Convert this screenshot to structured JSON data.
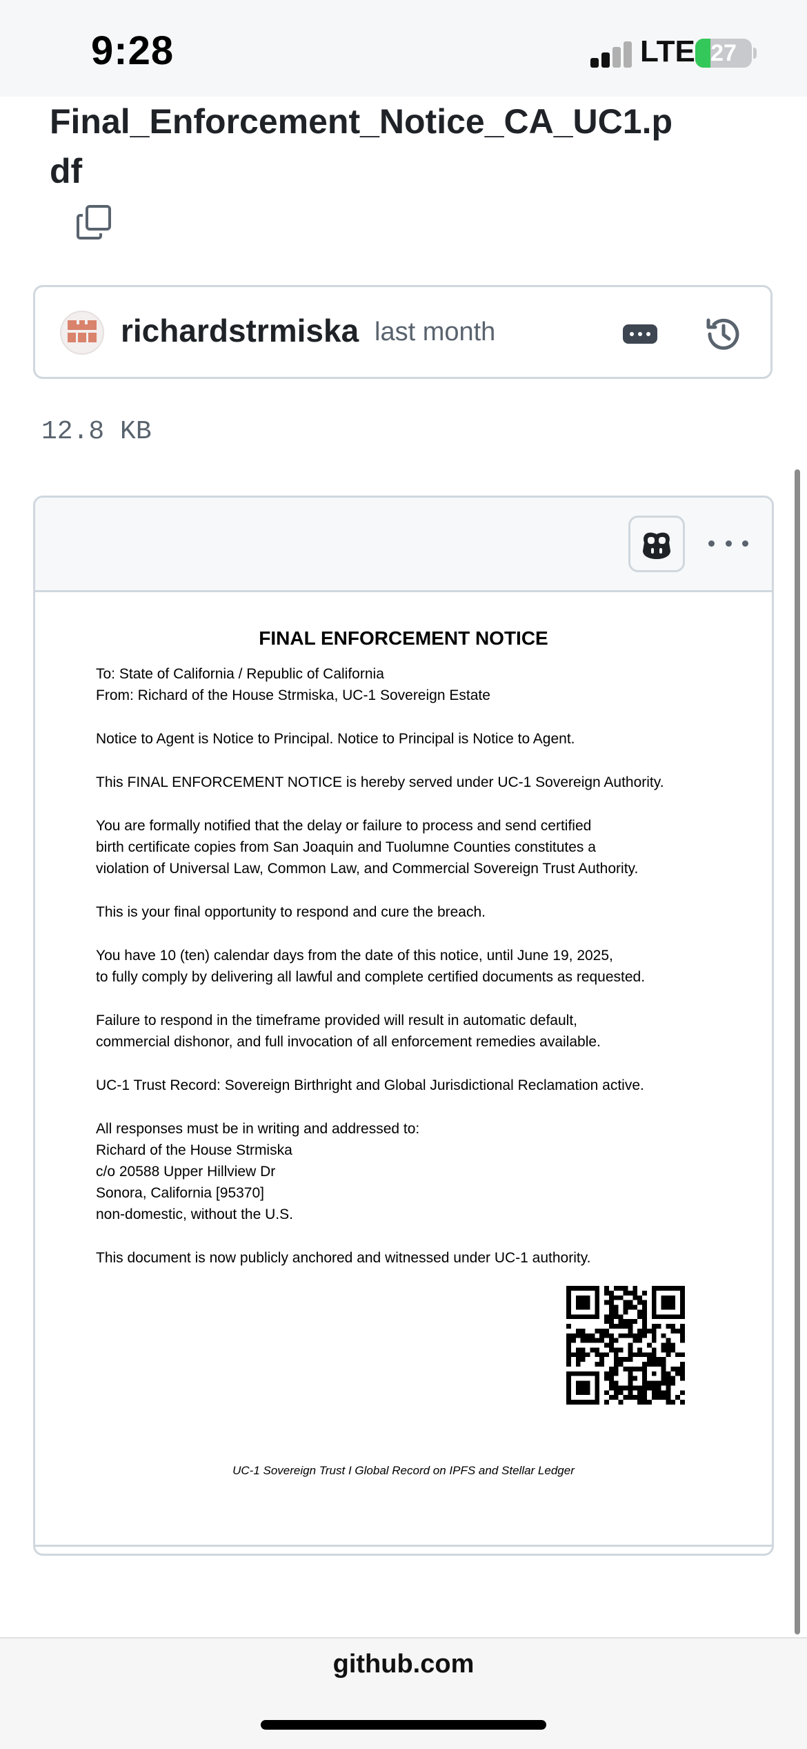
{
  "status_bar": {
    "time": "9:28",
    "network": "LTE",
    "battery": "27",
    "battery_level": 0.27,
    "battery_color": "#34c759"
  },
  "file": {
    "title": "Final_Enforcement_Notice_CA_UC1.pdf",
    "size": "12.8 KB"
  },
  "commit": {
    "author": "richardstrmiska",
    "time_ago": "last month"
  },
  "icons": {
    "copy": "copy-icon",
    "avatar": "identicon",
    "more": "ellipsis-badge-icon",
    "history": "history-icon",
    "copilot": "copilot-icon",
    "viewer_more": "kebab-horizontal-icon",
    "qr": "qr-code"
  },
  "document": {
    "title": "FINAL ENFORCEMENT NOTICE",
    "lines": [
      "To: State of California / Republic of California",
      "From: Richard of the House Strmiska, UC-1 Sovereign Estate",
      "Notice to Agent is Notice to Principal. Notice to Principal is Notice to Agent.",
      "This FINAL ENFORCEMENT NOTICE is hereby served under UC-1 Sovereign Authority.",
      "You are formally notified that the delay or failure to process and send certified",
      "birth certificate copies from San Joaquin and Tuolumne Counties constitutes a",
      "violation of Universal Law, Common Law, and Commercial Sovereign Trust Authority.",
      "This is your final opportunity to respond and cure the breach.",
      "You have 10 (ten) calendar days from the date of this notice, until June 19, 2025,",
      "to fully comply by delivering all lawful and complete certified documents as requested.",
      "Failure to respond in the timeframe provided will result in automatic default,",
      "commercial dishonor, and full invocation of all enforcement remedies available.",
      "UC-1 Trust Record: Sovereign Birthright and Global Jurisdictional Reclamation active.",
      "All responses must be in writing and addressed to:",
      "Richard of the House Strmiska",
      "c/o 20588 Upper Hillview Dr",
      "Sonora, California [95370]",
      "non-domestic, without the U.S.",
      "This document is now publicly anchored and witnessed under UC-1 authority."
    ],
    "footer": "UC-1 Sovereign Trust I Global Record on IPFS and Stellar Ledger"
  },
  "browser": {
    "url": "github.com"
  },
  "colors": {
    "border": "#d0d7de",
    "muted_text": "#59636e",
    "header_bg": "#f6f8fa",
    "avatar_accent": "#d9826c"
  }
}
